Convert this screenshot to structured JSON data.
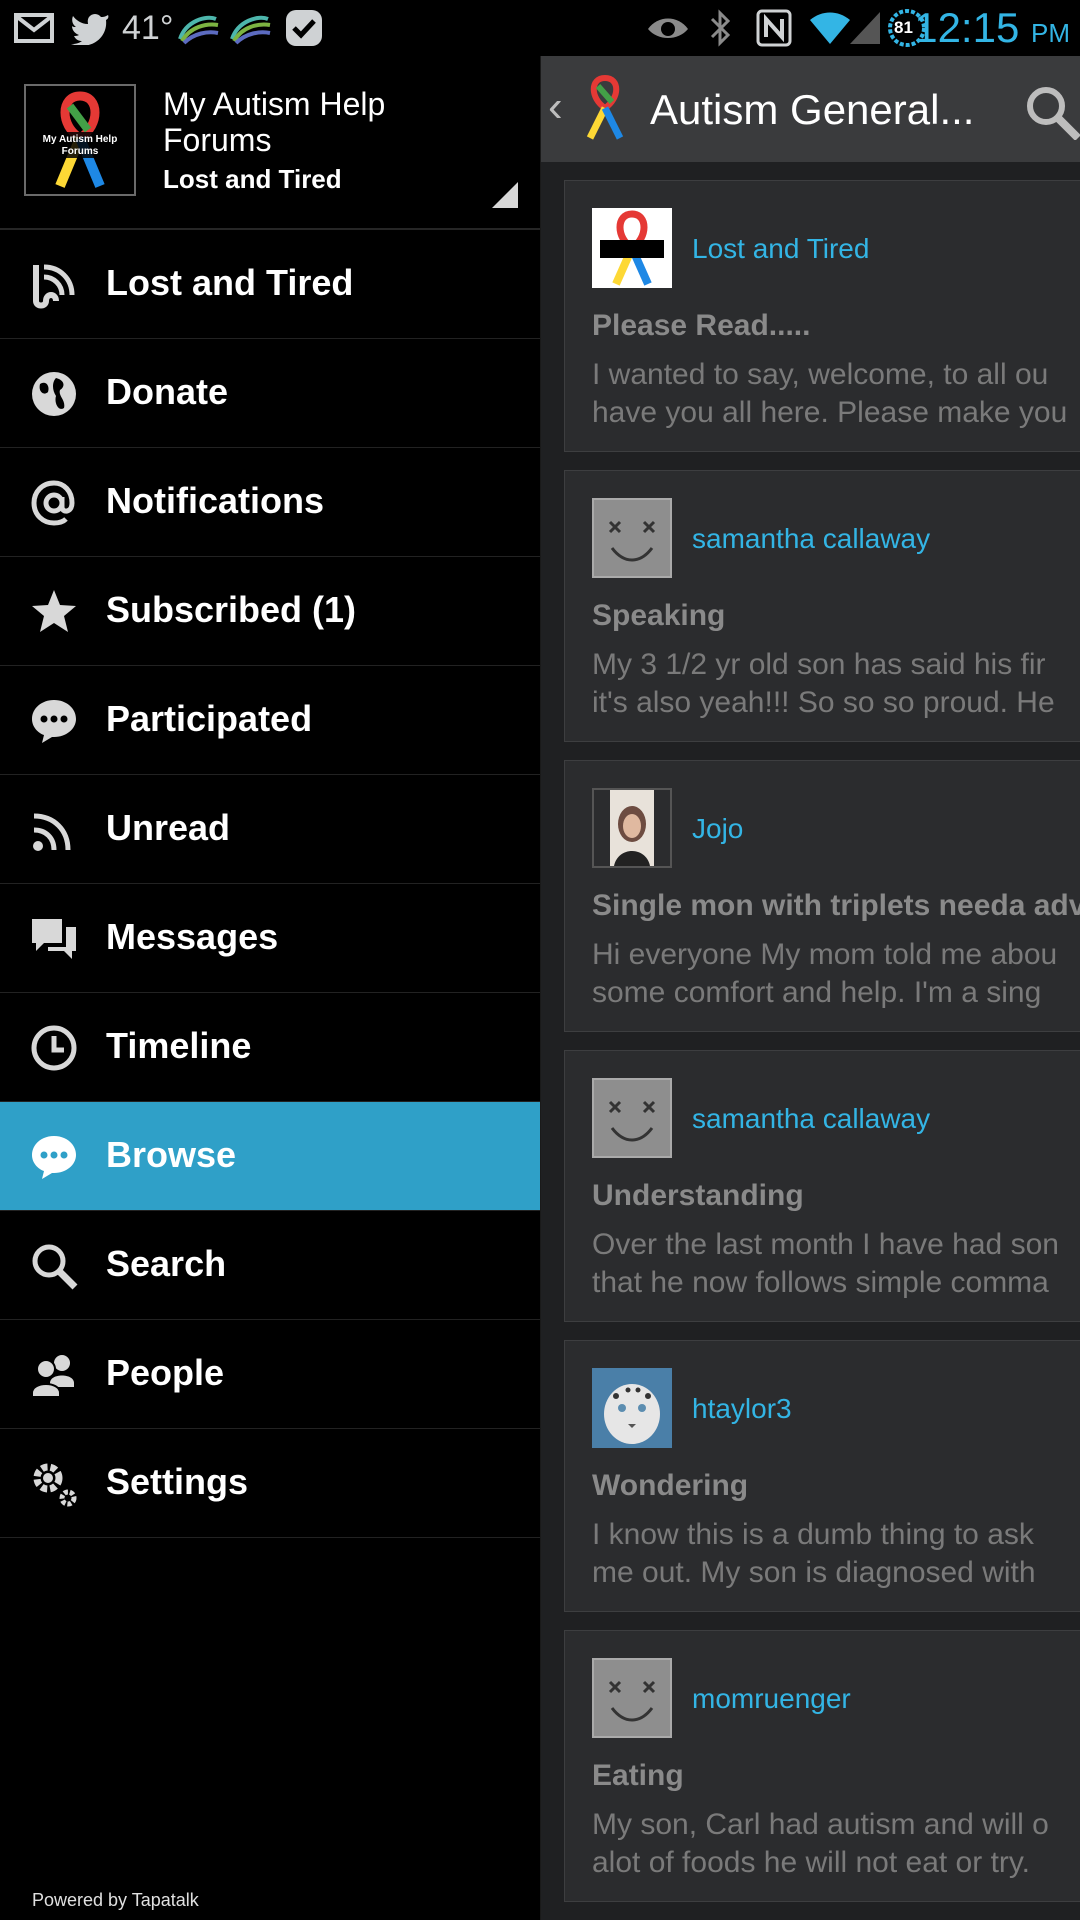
{
  "status_bar": {
    "temperature": "41°",
    "battery": "81",
    "time": "12:15",
    "ampm": "PM"
  },
  "drawer": {
    "forum_name": "My Autism Help Forums",
    "username": "Lost and Tired",
    "logo_text": "My Autism Help Forums",
    "menu": [
      {
        "label": "Lost and Tired",
        "icon": "feed-icon"
      },
      {
        "label": "Donate",
        "icon": "globe-icon"
      },
      {
        "label": "Notifications",
        "icon": "at-icon"
      },
      {
        "label": "Subscribed (1)",
        "icon": "star-icon"
      },
      {
        "label": "Participated",
        "icon": "chat-bubble-icon"
      },
      {
        "label": "Unread",
        "icon": "rss-icon"
      },
      {
        "label": "Messages",
        "icon": "messages-icon"
      },
      {
        "label": "Timeline",
        "icon": "clock-icon"
      },
      {
        "label": "Browse",
        "icon": "browse-icon",
        "active": true
      },
      {
        "label": "Search",
        "icon": "search-icon"
      },
      {
        "label": "People",
        "icon": "people-icon"
      },
      {
        "label": "Settings",
        "icon": "gear-icon"
      }
    ],
    "footer": "Powered by Tapatalk"
  },
  "content": {
    "title": "Autism General...",
    "posts": [
      {
        "author": "Lost and Tired",
        "title": "Please Read.....",
        "line1": "I wanted to say, welcome, to all ou",
        "line2": "have you all here. Please make you"
      },
      {
        "author": "samantha callaway",
        "title": "Speaking",
        "line1": "My 3 1/2 yr old son has said his fir",
        "line2": "it's also yeah!!! So so so proud. He"
      },
      {
        "author": "Jojo",
        "title": "Single mon with triplets needa adv",
        "line1": "Hi everyone My mom told me abou",
        "line2": "some comfort and help. I'm a sing"
      },
      {
        "author": "samantha callaway",
        "title": "Understanding",
        "line1": "Over the last month I have had son",
        "line2": "that he now follows simple comma"
      },
      {
        "author": "htaylor3",
        "title": "Wondering",
        "line1": "I know this is a dumb thing to ask",
        "line2": "me out. My son is diagnosed with"
      },
      {
        "author": "momruenger",
        "title": "Eating",
        "line1": "My son, Carl had autism and will o",
        "line2": "alot of foods he will not eat or try."
      }
    ]
  },
  "colors": {
    "accent": "#33b5e5",
    "active_item": "#2fa0c8"
  }
}
